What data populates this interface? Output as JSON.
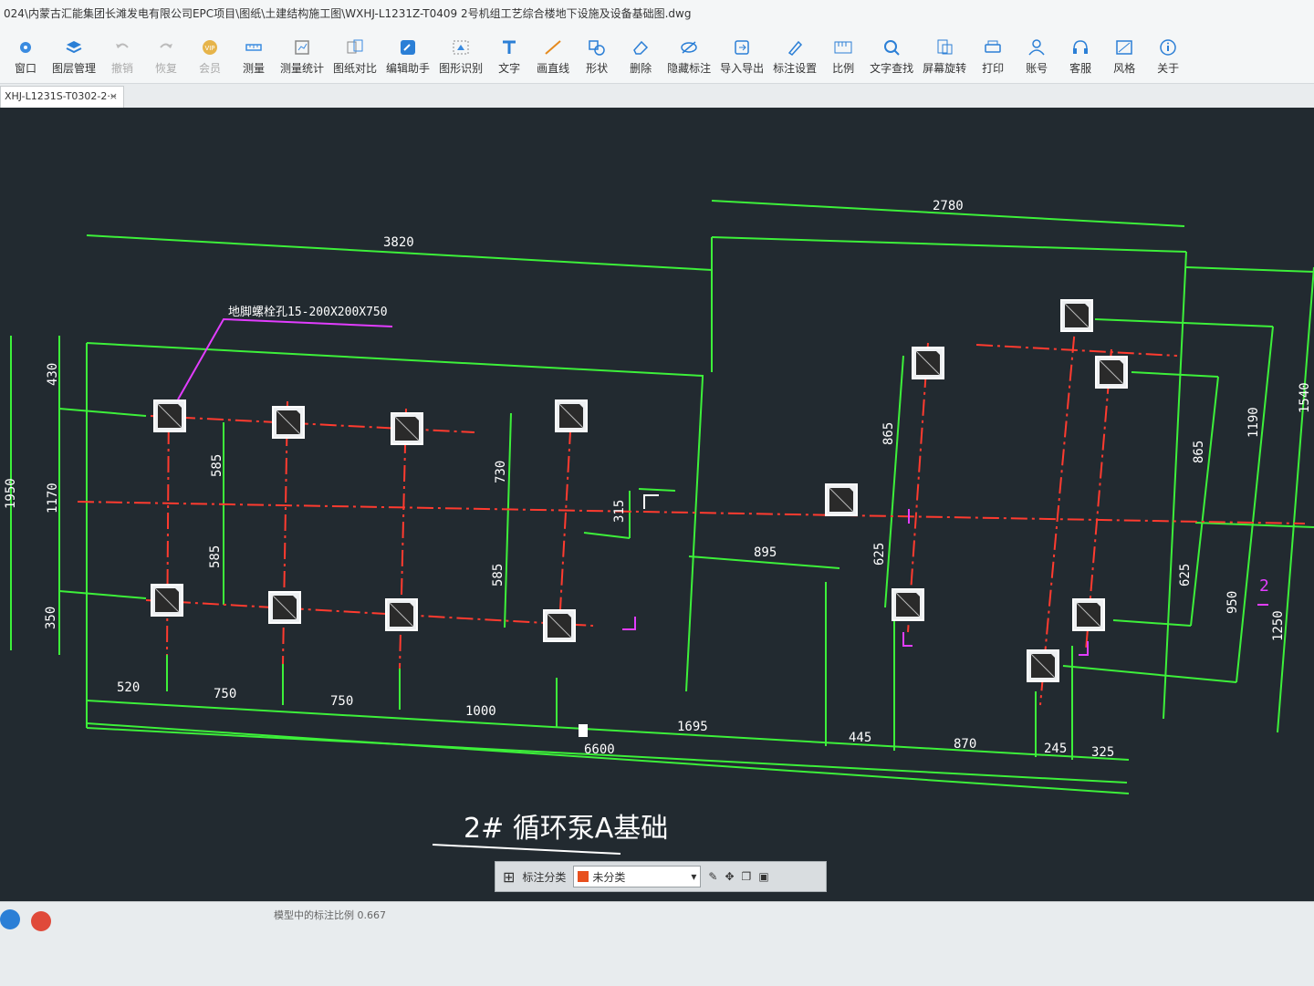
{
  "window": {
    "title": "024\\内蒙古汇能集团长滩发电有限公司EPC项目\\图纸\\土建结构施工图\\WXHJ-L1231Z-T0409 2号机组工艺综合楼地下设施及设备基础图.dwg"
  },
  "toolbar": {
    "items": [
      {
        "label": "窗口",
        "icon": "window-icon"
      },
      {
        "label": "图层管理",
        "icon": "layers-icon"
      },
      {
        "label": "撤销",
        "icon": "undo-icon"
      },
      {
        "label": "恢复",
        "icon": "redo-icon"
      },
      {
        "label": "会员",
        "icon": "vip-icon"
      },
      {
        "label": "测量",
        "icon": "measure-icon"
      },
      {
        "label": "测量统计",
        "icon": "measure-stats-icon"
      },
      {
        "label": "图纸对比",
        "icon": "compare-icon"
      },
      {
        "label": "编辑助手",
        "icon": "edit-assistant-icon"
      },
      {
        "label": "图形识别",
        "icon": "shape-recognize-icon"
      },
      {
        "label": "文字",
        "icon": "text-icon"
      },
      {
        "label": "画直线",
        "icon": "line-icon"
      },
      {
        "label": "形状",
        "icon": "shape-icon"
      },
      {
        "label": "删除",
        "icon": "eraser-icon"
      },
      {
        "label": "隐藏标注",
        "icon": "hide-annotation-icon"
      },
      {
        "label": "导入导出",
        "icon": "import-export-icon"
      },
      {
        "label": "标注设置",
        "icon": "annotation-settings-icon"
      },
      {
        "label": "比例",
        "icon": "scale-icon"
      },
      {
        "label": "文字查找",
        "icon": "text-search-icon"
      },
      {
        "label": "屏幕旋转",
        "icon": "rotate-screen-icon"
      },
      {
        "label": "打印",
        "icon": "print-icon"
      },
      {
        "label": "账号",
        "icon": "account-icon"
      },
      {
        "label": "客服",
        "icon": "support-icon"
      },
      {
        "label": "风格",
        "icon": "style-icon"
      },
      {
        "label": "关于",
        "icon": "about-icon"
      }
    ]
  },
  "tabs": [
    {
      "label": "XHJ-L1231S-T0302-2···",
      "close": "×"
    }
  ],
  "drawing": {
    "title": "2# 循环泵A基础",
    "bolt_note": "地脚螺栓孔15-200X200X750",
    "dimensions": {
      "top_left": "3820",
      "top_right": "2780",
      "left_outer": "1950",
      "left_top": "430",
      "left_mid": "1170",
      "left_bottom": "350",
      "inner_585_a": "585",
      "inner_585_b": "585",
      "inner_730": "730",
      "inner_585_c": "585",
      "inner_315": "315",
      "inner_895": "895",
      "inner_865_a": "865",
      "inner_625_a": "625",
      "inner_865_b": "865",
      "inner_625_b": "625",
      "right_1190": "1190",
      "right_1540": "1540",
      "right_950": "950",
      "right_1250": "1250",
      "bottom_520": "520",
      "bottom_750_a": "750",
      "bottom_750_b": "750",
      "bottom_1000": "1000",
      "bottom_1695": "1695",
      "bottom_445": "445",
      "bottom_870": "870",
      "bottom_245": "245",
      "bottom_325": "325",
      "bottom_total": "6600"
    },
    "markers": {
      "section_mark": "2"
    }
  },
  "annotation_toolbar": {
    "label": "标注分类",
    "selected": "未分类",
    "swatch_color": "#e8501e"
  },
  "status": {
    "text": "模型中的标注比例 0.667"
  },
  "colors": {
    "green": "#3df03a",
    "red": "#ff3b2f",
    "magenta": "#e23dff",
    "white": "#ffffff",
    "canvas": "#222a30"
  }
}
